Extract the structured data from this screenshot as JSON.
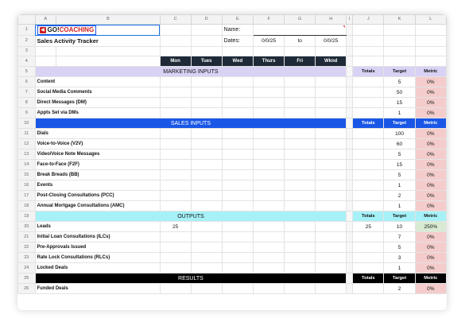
{
  "columns": [
    "A",
    "B",
    "C",
    "D",
    "E",
    "F",
    "G",
    "H",
    "I",
    "J",
    "K",
    "L"
  ],
  "logo": {
    "go": "GO!",
    "coaching": "COACHING"
  },
  "title": "Sales Activity Tracker",
  "name_label": "Name:",
  "dates": {
    "label": "Dates:",
    "start": "0/0/25",
    "to": "to",
    "end": "0/0/25"
  },
  "days": [
    "Mon",
    "Tues",
    "Wed",
    "Thurs",
    "Fri",
    "Wknd"
  ],
  "totals_label": "Totals",
  "target_label": "Target",
  "metric_label": "Metric",
  "sections": {
    "marketing": "MARKETING INPUTS",
    "sales": "SALES INPUTS",
    "outputs": "OUTPUTS",
    "results": "RESULTS"
  },
  "marketing_rows": [
    {
      "row": "6",
      "label": "Content",
      "target": "5",
      "metric": "0%"
    },
    {
      "row": "7",
      "label": "Social Media Comments",
      "target": "50",
      "metric": "0%"
    },
    {
      "row": "8",
      "label": "Direct Messages (DM)",
      "target": "15",
      "metric": "0%"
    },
    {
      "row": "9",
      "label": "Appts Set via DMs",
      "target": "1",
      "metric": "0%"
    }
  ],
  "sales_rows": [
    {
      "row": "11",
      "label": "Dials",
      "target": "100",
      "metric": "0%"
    },
    {
      "row": "12",
      "label": "Voice-to-Voice (V2V)",
      "target": "60",
      "metric": "0%"
    },
    {
      "row": "13",
      "label": "Video/Voice Note Messages",
      "target": "5",
      "metric": "0%"
    },
    {
      "row": "14",
      "label": "Face-to-Face (F2F)",
      "target": "15",
      "metric": "0%"
    },
    {
      "row": "15",
      "label": "Break Breads (BB)",
      "target": "5",
      "metric": "0%"
    },
    {
      "row": "16",
      "label": "Events",
      "target": "1",
      "metric": "0%"
    },
    {
      "row": "17",
      "label": "Post-Closing Consultations (PCC)",
      "target": "2",
      "metric": "0%"
    },
    {
      "row": "18",
      "label": "Annual Mortgage Consultations (AMC)",
      "target": "1",
      "metric": "0%"
    }
  ],
  "outputs_rows": [
    {
      "row": "20",
      "label": "Leads",
      "mon": "25",
      "total": "25",
      "target": "10",
      "metric": "250%"
    },
    {
      "row": "21",
      "label": "Initial Loan Consultations (ILCs)",
      "mon": "",
      "total": "",
      "target": "7",
      "metric": "0%"
    },
    {
      "row": "22",
      "label": "Pre-Approvals Issued",
      "mon": "",
      "total": "",
      "target": "5",
      "metric": "0%"
    },
    {
      "row": "23",
      "label": "Rate Lock Consultations (RLCs)",
      "mon": "",
      "total": "",
      "target": "3",
      "metric": "0%"
    },
    {
      "row": "24",
      "label": "Locked Deals",
      "mon": "",
      "total": "",
      "target": "1",
      "metric": "0%"
    }
  ],
  "results_rows": [
    {
      "row": "26",
      "label": "Funded Deals",
      "target": "2",
      "metric": "0%"
    }
  ],
  "row_numbers": {
    "r1": "1",
    "r2": "2",
    "r3": "3",
    "r4": "4",
    "r5": "5",
    "r10": "10",
    "r19": "19",
    "r25": "25"
  },
  "colors": {
    "marketing": "#d9d2f4",
    "sales": "#1a57e6",
    "outputs": "#a6f1f7",
    "results": "#000000",
    "metric_zero": "#f4cccc",
    "metric_hit": "#d9ead3",
    "day_header": "#1f2a38"
  }
}
